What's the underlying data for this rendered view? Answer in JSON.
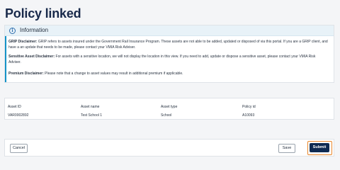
{
  "page": {
    "title": "Policy linked"
  },
  "info": {
    "title": "Information",
    "icon": "info-icon",
    "grip_label": "GRIP Disclaimer:",
    "grip_text_1": " GRIP refers to assets insured under the Government Rail Insurance Program. These assets are not able to be added, updated or disposed of via this portal. If you are a GRIP client, and",
    "grip_text_2": "have a an update that needs to be made, please contact your VMIA Risk Adviser.",
    "sensitive_label": "Sensitive Asset Disclaimer:",
    "sensitive_text_1": " For assets with a sensitive location, we will not display the location in this view. If you need to add, update or dispose a sensitive asset, please contact your VMIA Risk",
    "sensitive_text_2": "Adviser.",
    "premium_label": "Premium Disclaimer:",
    "premium_text": " Please note that a change to asset values may result in additional premium if applicable."
  },
  "table": {
    "columns": [
      "Asset ID",
      "Asset name",
      "Asset type",
      "Policy id"
    ],
    "rows": [
      [
        "VAR0002892",
        "Test School 1",
        "School",
        "A10093"
      ]
    ]
  },
  "footer": {
    "cancel_label": "Cancel",
    "save_label": "Save",
    "submit_label": "Submit"
  },
  "colors": {
    "accent": "#1593c8",
    "primary": "#0e2a52",
    "focus": "#e8862a"
  }
}
